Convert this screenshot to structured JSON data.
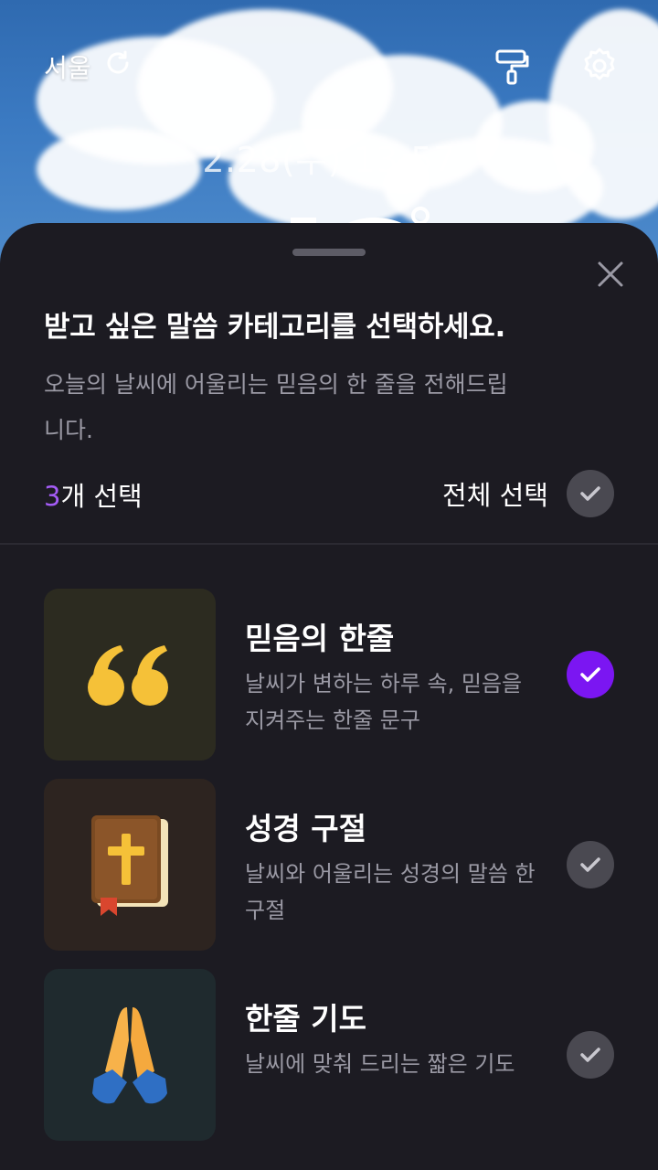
{
  "header": {
    "city": "서울",
    "datetime": "2.28(수) 13:57"
  },
  "sheet": {
    "title": "받고 싶은 말씀 카테고리를 선택하세요.",
    "subtitle": "오늘의 날씨에 어울리는 믿음의 한 줄을 전해드립니다.",
    "selected_count": "3",
    "selected_suffix": "개 선택",
    "select_all_label": "전체 선택"
  },
  "categories": [
    {
      "title": "믿음의 한줄",
      "description": "날씨가 변하는 하루 속, 믿음을 지켜주는 한줄 문구",
      "icon": "quote-icon",
      "checked": true
    },
    {
      "title": "성경 구절",
      "description": "날씨와 어울리는 성경의 말씀 한 구절",
      "icon": "bible-icon",
      "checked": false
    },
    {
      "title": "한줄 기도",
      "description": "날씨에 맞춰 드리는 짧은 기도",
      "icon": "praying-hands-icon",
      "checked": false
    }
  ],
  "colors": {
    "accent": "#7b16f2",
    "count_accent": "#a45cf6",
    "sheet_bg": "#1c1b22",
    "unchecked": "#4a4951"
  }
}
